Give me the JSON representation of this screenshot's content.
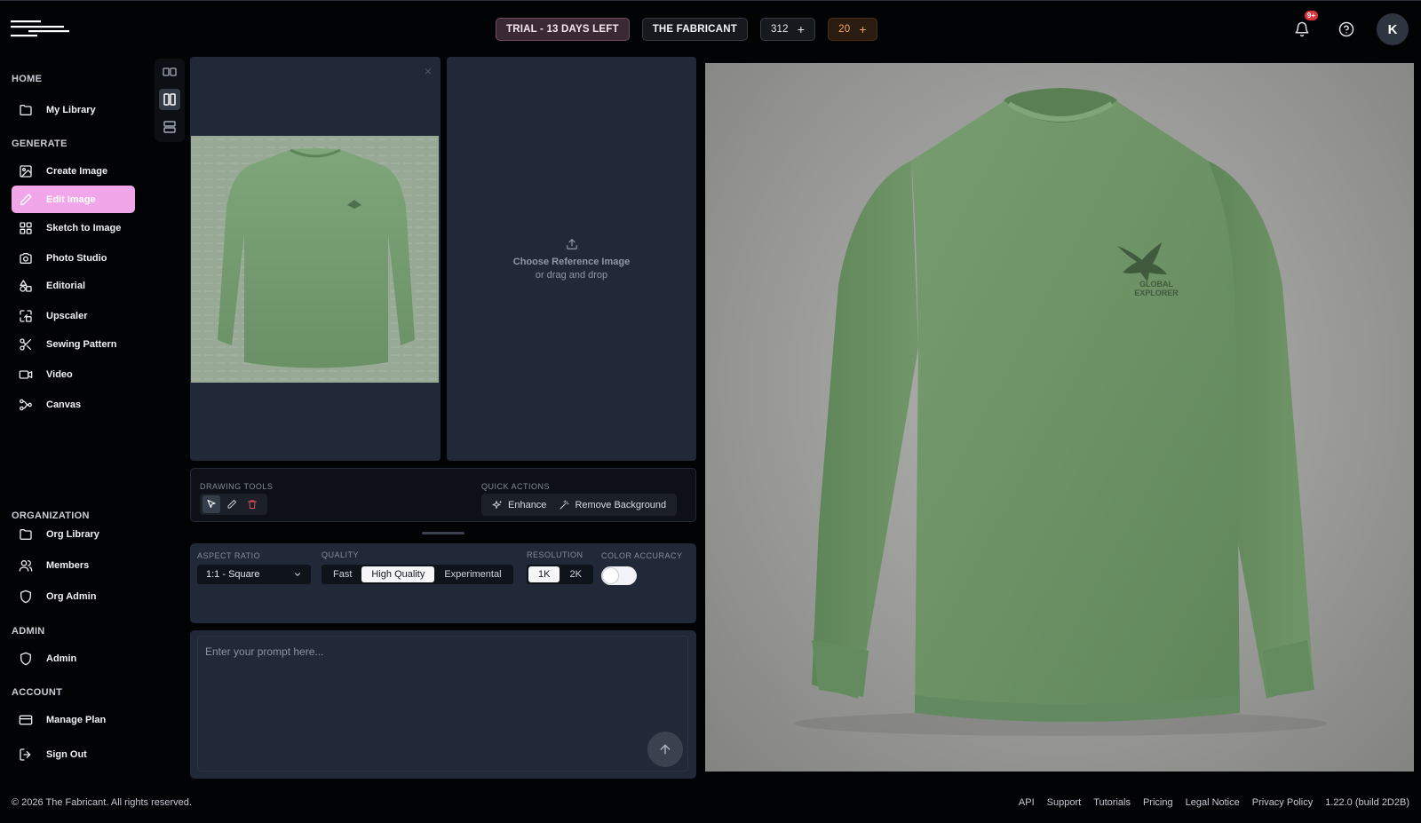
{
  "header": {
    "trial_label": "TRIAL - 13 DAYS LEFT",
    "org_name": "THE FABRICANT",
    "credits": "312",
    "orange_credits": "20",
    "plus": "+",
    "notification_badge": "9+",
    "avatar_initial": "K"
  },
  "sidebar": {
    "sections": {
      "home": "HOME",
      "generate": "GENERATE",
      "organization": "ORGANIZATION",
      "admin": "ADMIN",
      "account": "ACCOUNT"
    },
    "items": {
      "my_library": "My Library",
      "create_image": "Create Image",
      "edit_image": "Edit Image",
      "sketch_to_image": "Sketch to Image",
      "photo_studio": "Photo Studio",
      "editorial": "Editorial",
      "upscaler": "Upscaler",
      "sewing_pattern": "Sewing Pattern",
      "video": "Video",
      "canvas": "Canvas",
      "org_library": "Org Library",
      "members": "Members",
      "org_admin": "Org Admin",
      "admin": "Admin",
      "manage_plan": "Manage Plan",
      "sign_out": "Sign Out"
    },
    "active": "edit_image"
  },
  "workspace": {
    "close": "×",
    "reference": {
      "title": "Choose Reference Image",
      "subtitle": "or drag and drop"
    },
    "drawing_tools_label": "DRAWING TOOLS",
    "quick_actions_label": "QUICK ACTIONS",
    "quick_actions": {
      "enhance": "Enhance",
      "remove_background": "Remove Background"
    }
  },
  "settings": {
    "aspect_ratio_label": "ASPECT RATIO",
    "aspect_ratio_value": "1:1 - Square",
    "quality_label": "QUALITY",
    "quality_options": [
      "Fast",
      "High Quality",
      "Experimental"
    ],
    "quality_selected": "High Quality",
    "resolution_label": "RESOLUTION",
    "resolution_options": [
      "1K",
      "2K"
    ],
    "resolution_selected": "1K",
    "color_accuracy_label": "COLOR ACCURACY",
    "color_accuracy_on": false
  },
  "prompt": {
    "placeholder": "Enter your prompt here...",
    "value": ""
  },
  "preview": {
    "logo_line1": "GLOBAL",
    "logo_line2": "EXPLORER"
  },
  "footer": {
    "copyright": "© 2026 The Fabricant. All rights reserved.",
    "links": {
      "api": "API",
      "support": "Support",
      "tutorials": "Tutorials",
      "pricing": "Pricing",
      "legal": "Legal Notice",
      "privacy": "Privacy Policy"
    },
    "version": "1.22.0 (build 2D2B)"
  },
  "colors": {
    "accent_pink": "#f0a6e8",
    "panel": "#212837",
    "background": "#020305",
    "garment_green": "#6f9369"
  }
}
